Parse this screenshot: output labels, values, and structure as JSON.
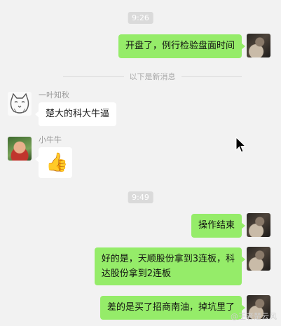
{
  "chat": {
    "time_1": "9:26",
    "time_2": "9:49",
    "new_messages_divider": "以下是新消息",
    "messages": [
      {
        "sender": "self",
        "text": "开盘了，例行检验盘面时间"
      },
      {
        "sender": "一叶知秋",
        "text": "楚大的科大牛逼"
      },
      {
        "sender": "小牛牛",
        "text": "👍"
      },
      {
        "sender": "self",
        "text": "操作结束"
      },
      {
        "sender": "self",
        "text_line1": "好的是，天顺股份拿到3连板，科",
        "text_line2": "达股份拿到2连板"
      },
      {
        "sender": "self",
        "text": "差的是买了招商南油，掉坑里了"
      }
    ]
  },
  "watermark": "@王者楚云风",
  "colors": {
    "background": "#f2f2f2",
    "self_bubble": "#95ec69",
    "other_bubble": "#ffffff",
    "time_badge": "#dadada"
  },
  "icons": [
    "cursor-arrow-icon",
    "thumbs-up-icon"
  ]
}
